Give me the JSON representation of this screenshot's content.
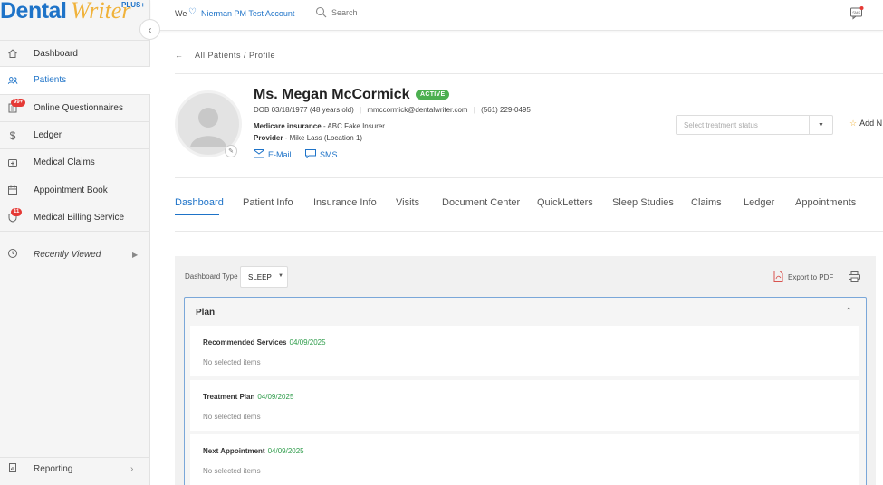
{
  "app": {
    "logo_main": "Dental",
    "logo_script": "Writer",
    "logo_suffix": "PLUS+"
  },
  "sidebar": {
    "items": [
      {
        "label": "Dashboard",
        "icon": "home-icon"
      },
      {
        "label": "Patients",
        "icon": "patients-icon",
        "active": true
      },
      {
        "label": "Online Questionnaires",
        "icon": "questionnaire-icon",
        "badge": "99+"
      },
      {
        "label": "Ledger",
        "icon": "dollar-icon"
      },
      {
        "label": "Medical Claims",
        "icon": "medical-claims-icon"
      },
      {
        "label": "Appointment Book",
        "icon": "calendar-icon"
      },
      {
        "label": "Medical Billing Service",
        "icon": "billing-icon",
        "badge": "11"
      }
    ],
    "recently_viewed": "Recently Viewed",
    "reporting": "Reporting"
  },
  "topbar": {
    "we": "We",
    "account": "Nierman PM Test Account",
    "search_placeholder": "Search"
  },
  "breadcrumb": {
    "text": "All Patients / Profile"
  },
  "patient": {
    "name": "Ms. Megan McCormick",
    "status": "ACTIVE",
    "dob_label": "DOB",
    "dob": "03/18/1977",
    "age": "(48 years old)",
    "email": "mmccormick@dentalwriter.com",
    "phone": "(561) 229-0495",
    "insurance_label": "Medicare insurance",
    "insurance_sep": "-",
    "insurance": "ABC Fake Insurer",
    "provider_label": "Provider",
    "provider": "- Mike Lass (Location 1)",
    "email_action": "E-Mail",
    "sms_action": "SMS"
  },
  "treatment": {
    "placeholder": "Select treatment status",
    "add_label": "Add N"
  },
  "tabs": [
    {
      "label": "Dashboard",
      "active": true
    },
    {
      "label": "Patient Info"
    },
    {
      "label": "Insurance Info"
    },
    {
      "label": "Visits"
    },
    {
      "label": "Document Center"
    },
    {
      "label": "QuickLetters"
    },
    {
      "label": "Sleep Studies"
    },
    {
      "label": "Claims"
    },
    {
      "label": "Ledger"
    },
    {
      "label": "Appointments"
    }
  ],
  "dashboard": {
    "type_label": "Dashboard Type",
    "type_value": "SLEEP",
    "export_label": "Export to PDF"
  },
  "plan": {
    "title": "Plan",
    "cards": [
      {
        "title": "Recommended Services",
        "date": "04/09/2025",
        "empty": "No selected items"
      },
      {
        "title": "Treatment Plan",
        "date": "04/09/2025",
        "empty": "No selected items"
      },
      {
        "title": "Next Appointment",
        "date": "04/09/2025",
        "empty": "No selected items"
      }
    ]
  },
  "colors": {
    "brand_blue": "#1e73c8",
    "accent_gold": "#f0b23a",
    "active_green": "#4caf50",
    "date_green": "#2e9c4a",
    "badge_red": "#e53935"
  }
}
